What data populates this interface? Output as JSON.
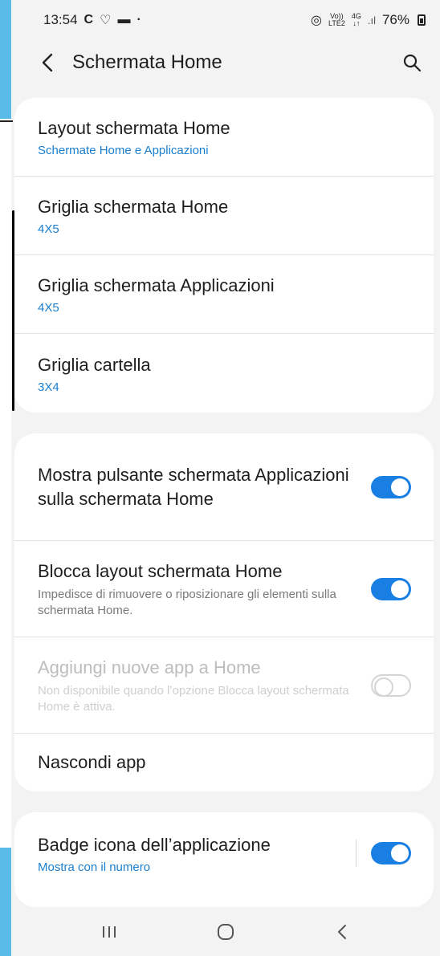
{
  "status": {
    "time": "13:54",
    "battery": "76%",
    "net_top": "Vo))",
    "net_bottom": "LTE2",
    "gen_top": "4G",
    "gen_bottom": "↓↑"
  },
  "appbar": {
    "title": "Schermata Home"
  },
  "section1": {
    "items": [
      {
        "title": "Layout schermata Home",
        "value": "Schermate Home e Applicazioni"
      },
      {
        "title": "Griglia schermata Home",
        "value": "4X5"
      },
      {
        "title": "Griglia schermata Applicazioni",
        "value": "4X5"
      },
      {
        "title": "Griglia cartella",
        "value": "3X4"
      }
    ]
  },
  "section2": {
    "items": [
      {
        "title": "Mostra pulsante schermata Applicazioni sulla schermata Home",
        "toggle": "on"
      },
      {
        "title": "Blocca layout schermata Home",
        "desc": "Impedisce di rimuovere o riposizionare gli elementi sulla schermata Home.",
        "toggle": "on"
      },
      {
        "title": "Aggiungi nuove app a Home",
        "desc": "Non disponibile quando l’opzione Blocca layout schermata Home è attiva.",
        "toggle": "off",
        "disabled": true
      },
      {
        "title": "Nascondi app"
      }
    ]
  },
  "section3": {
    "items": [
      {
        "title": "Badge icona dell’applicazione",
        "value": "Mostra con il numero",
        "toggle": "on"
      }
    ]
  },
  "colors": {
    "accent": "#1a7fe3",
    "link": "#1a7fcf",
    "background": "#f3f3f3"
  }
}
